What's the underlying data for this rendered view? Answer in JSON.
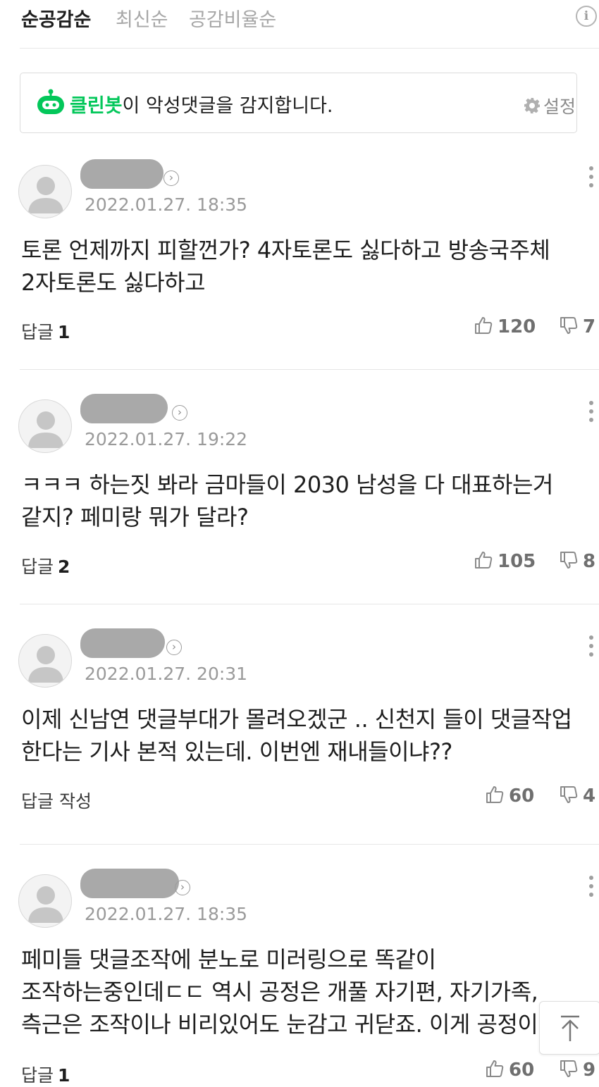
{
  "sort_tabs": [
    {
      "label": "순공감순",
      "active": true
    },
    {
      "label": "최신순",
      "active": false
    },
    {
      "label": "공감비율순",
      "active": false
    }
  ],
  "info_icon": "info-icon",
  "cleanbot": {
    "name": "클린봇",
    "message": "이 악성댓글을 감지합니다.",
    "settings_label": "설정",
    "brand_color": "#03c75a"
  },
  "comments": [
    {
      "timestamp": "2022.01.27. 18:35",
      "text": "토론 언제까지 피할껀가? 4자토론도 싫다하고 방송국주체 2자토론도 싫다하고",
      "reply_label": "답글",
      "reply_count": "1",
      "likes": "120",
      "dislikes": "7"
    },
    {
      "timestamp": "2022.01.27. 19:22",
      "text": "ㅋㅋㅋ 하는짓 봐라 금마들이 2030 남성을 다 대표하는거 같지? 페미랑 뭐가 달라?",
      "reply_label": "답글",
      "reply_count": "2",
      "likes": "105",
      "dislikes": "8"
    },
    {
      "timestamp": "2022.01.27. 20:31",
      "text": "이제 신남연 댓글부대가 몰려오겠군 .. 신천지 들이 댓글작업 한다는 기사 본적 있는데. 이번엔 재내들이냐??",
      "reply_label": "답글 작성",
      "reply_count": "",
      "likes": "60",
      "dislikes": "4"
    },
    {
      "timestamp": "2022.01.27. 18:35",
      "text": "페미들 댓글조작에 분노로 미러링으로 똑같이 조작하는중인데ㄷㄷ 역시 공정은 개풀 자기편, 자기가족, 측근은 조작이나 비리있어도 눈감고 귀닫죠. 이게 공정이가",
      "reply_label": "답글",
      "reply_count": "1",
      "likes": "60",
      "dislikes": "9"
    }
  ],
  "icons": {
    "like": "thumbs-up-icon",
    "dislike": "thumbs-down-icon",
    "more": "more-vertical-icon",
    "scroll_top": "arrow-up-icon"
  }
}
